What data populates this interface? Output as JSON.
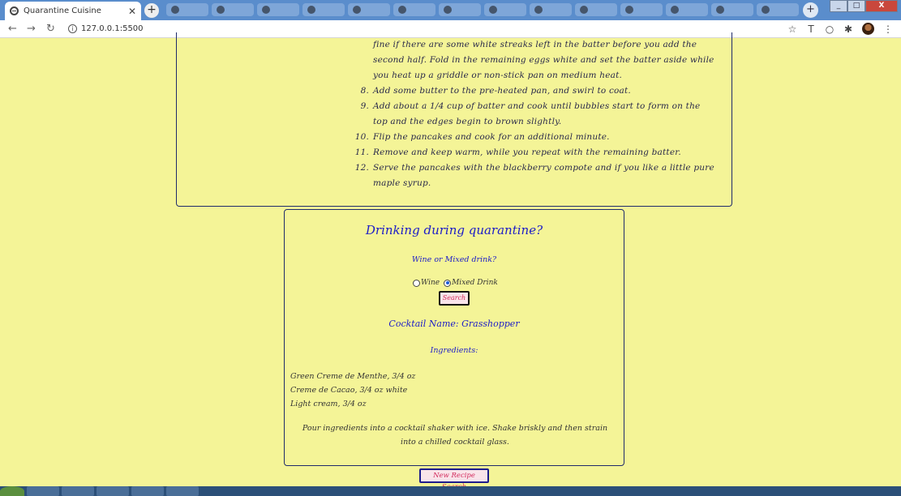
{
  "browser": {
    "tab_title": "Quarantine Cuisine",
    "url": "127.0.0.1:5500"
  },
  "recipe": {
    "steps": [
      {
        "num": "",
        "text": "fine if there are some white streaks left in the batter before you add the"
      },
      {
        "num": "",
        "text": "second half. Fold in the remaining eggs white and set the batter aside while"
      },
      {
        "num": "",
        "text": "you heat up a griddle or non-stick pan on medium heat."
      },
      {
        "num": "8.",
        "text": "Add some butter to the pre-heated pan, and swirl to coat."
      },
      {
        "num": "9.",
        "text": "Add about a 1/4 cup of batter and cook until bubbles start to form on the"
      },
      {
        "num": "",
        "text": "top and the edges begin to brown slightly."
      },
      {
        "num": "10.",
        "text": "Flip the pancakes and cook for an additional minute."
      },
      {
        "num": "11.",
        "text": "Remove and keep warm, while you repeat with the remaining batter."
      },
      {
        "num": "12.",
        "text": "Serve the pancakes with the blackberry compote and if you like a little pure"
      },
      {
        "num": "",
        "text": "maple syrup."
      }
    ]
  },
  "drink": {
    "heading": "Drinking during quarantine?",
    "question": "Wine or Mixed drink?",
    "options": [
      {
        "label": "Wine",
        "checked": false
      },
      {
        "label": "Mixed Drink",
        "checked": true
      }
    ],
    "search_label": "Search",
    "cocktail_name": "Cocktail Name: Grasshopper",
    "ingredients_title": "Ingredients:",
    "ingredients": [
      "Green Creme de Menthe, 3/4 oz",
      "Creme de Cacao, 3/4 oz white",
      "Light cream, 3/4 oz"
    ],
    "instructions": "Pour ingredients into a cocktail shaker with ice. Shake briskly and then strain into a chilled cocktail glass."
  },
  "new_recipe_label": "New Recipe Search"
}
